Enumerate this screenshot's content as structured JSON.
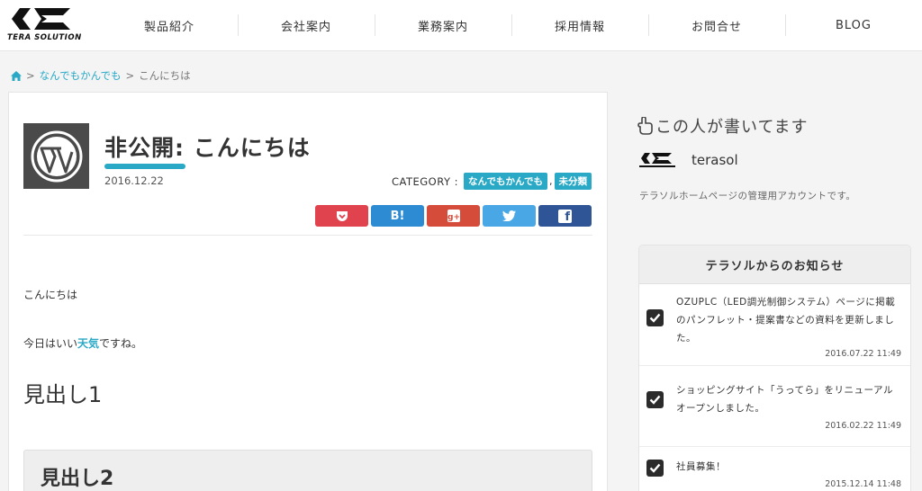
{
  "header": {
    "logo_text": "TERA SOLUTION",
    "nav": [
      "製品紹介",
      "会社案内",
      "業務案内",
      "採用情報",
      "お問合せ",
      "BLOG"
    ]
  },
  "breadcrumb": {
    "home_icon": "home-icon",
    "items": [
      "なんでもかんでも",
      "こんにちは"
    ],
    "separator": ">"
  },
  "post": {
    "title": "非公開: こんにちは",
    "date": "2016.12.22",
    "category_label": "CATEGORY :",
    "categories": [
      "なんでもかんでも",
      "未分類"
    ],
    "category_separator": ",",
    "share": [
      {
        "name": "pocket",
        "label": "",
        "color": "#e0424e"
      },
      {
        "name": "hatena",
        "label": "B!",
        "color": "#2d8bd4"
      },
      {
        "name": "google-plus",
        "label": "g+",
        "color": "#d64c3b"
      },
      {
        "name": "twitter",
        "label": "",
        "color": "#4aa7e6"
      },
      {
        "name": "facebook",
        "label": "f",
        "color": "#2f5597"
      }
    ],
    "paragraph1": "こんにちは",
    "paragraph2_before": "今日はいい",
    "paragraph2_highlight": "天気",
    "paragraph2_after": "ですね。",
    "heading1": "見出し1",
    "heading2": "見出し2"
  },
  "sidebar": {
    "author_heading": "この人が書いてます",
    "author_name": "terasol",
    "author_desc": "テラソルホームページの管理用アカウントです。",
    "news_heading": "テラソルからのお知らせ",
    "news": [
      {
        "text": "OZUPLC（LED調光制御システム）ページに掲載のパンフレット・提案書などの資料を更新しました。",
        "date": "2016.07.22 11:49"
      },
      {
        "text": "ショッピングサイト「うってら」をリニューアルオープンしました。",
        "date": "2016.02.22 11:49"
      },
      {
        "text": "社員募集！",
        "date": "2015.12.14 11:48"
      }
    ]
  },
  "colors": {
    "accent": "#29a9c6"
  }
}
